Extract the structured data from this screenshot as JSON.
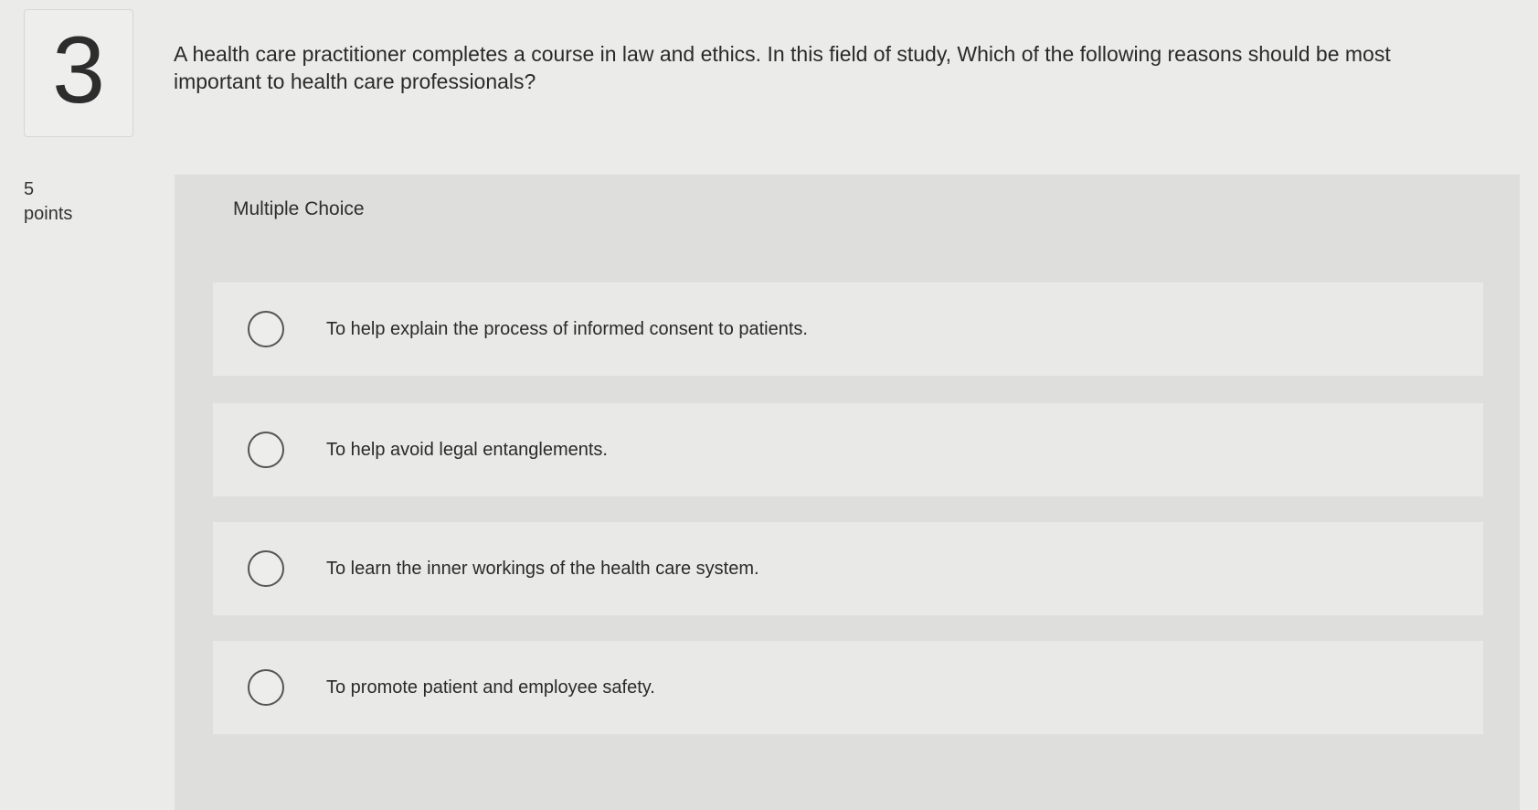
{
  "question": {
    "number": "3",
    "text": "A health care practitioner completes a course in law and ethics. In this field of study, Which of the following reasons should be most important to health care professionals?",
    "points_value": "5",
    "points_label": "points"
  },
  "answer": {
    "type_label": "Multiple Choice",
    "choices": [
      {
        "label": "To help explain the process of informed consent to patients."
      },
      {
        "label": "To help avoid legal entanglements."
      },
      {
        "label": "To learn the inner workings of the health care system."
      },
      {
        "label": "To promote patient and employee safety."
      }
    ]
  },
  "colors": {
    "background": "#ebebea",
    "panel": "#dededd",
    "choice_row": "#e9e9e8",
    "text": "#2a2a2a"
  }
}
